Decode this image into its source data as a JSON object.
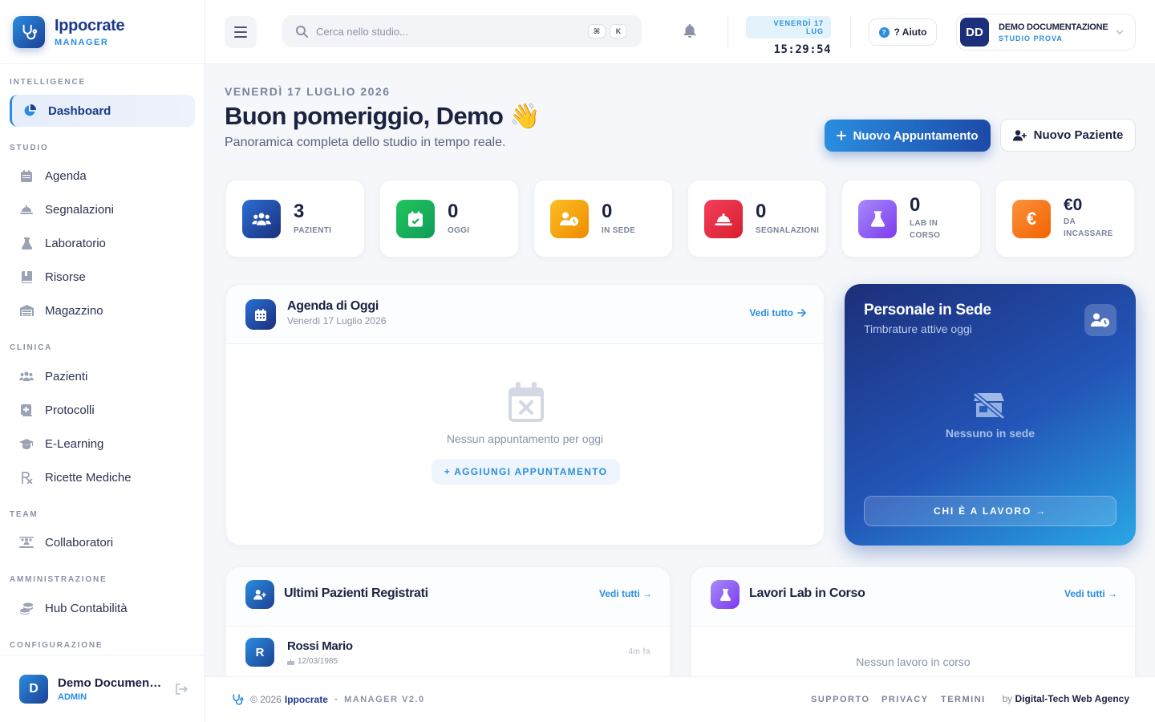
{
  "brand": {
    "name": "Ippocrate",
    "subtitle": "MANAGER"
  },
  "sidebar": {
    "sections": [
      {
        "label": "INTELLIGENCE"
      },
      {
        "label": "STUDIO"
      },
      {
        "label": "CLINICA"
      },
      {
        "label": "TEAM"
      },
      {
        "label": "AMMINISTRAZIONE"
      },
      {
        "label": "CONFIGURAZIONE"
      }
    ],
    "items": [
      {
        "label": "Dashboard",
        "icon": "chart-pie-icon",
        "active": true
      },
      {
        "label": "Agenda",
        "icon": "calendar-icon"
      },
      {
        "label": "Segnalazioni",
        "icon": "bell-concierge-icon"
      },
      {
        "label": "Laboratorio",
        "icon": "flask-icon"
      },
      {
        "label": "Risorse",
        "icon": "book-icon"
      },
      {
        "label": "Magazzino",
        "icon": "warehouse-icon"
      },
      {
        "label": "Pazienti",
        "icon": "users-icon"
      },
      {
        "label": "Protocolli",
        "icon": "notes-medical-icon"
      },
      {
        "label": "E-Learning",
        "icon": "graduation-cap-icon"
      },
      {
        "label": "Ricette Mediche",
        "icon": "prescription-icon"
      },
      {
        "label": "Collaboratori",
        "icon": "users-rectangle-icon"
      },
      {
        "label": "Hub Contabilità",
        "icon": "coins-icon"
      }
    ],
    "user": {
      "initial": "D",
      "name": "Demo Documentazione",
      "role": "ADMIN"
    }
  },
  "topbar": {
    "search_placeholder": "Cerca nello studio...",
    "shortcut": [
      "⌘",
      "K"
    ],
    "clock_date": "VENERDÌ 17 LUG",
    "clock_time": "15:29:54",
    "help_label": "? Aiuto",
    "profile": {
      "initials": "DD",
      "name": "DEMO DOCUMENTAZIONE",
      "studio": "STUDIO PROVA"
    }
  },
  "header": {
    "date": "VENERDÌ 17 LUGLIO 2026",
    "title": "Buon pomeriggio, Demo 👋",
    "subtitle": "Panoramica completa dello studio in tempo reale.",
    "primary_button": "Nuovo Appuntamento",
    "secondary_button": "Nuovo Paziente"
  },
  "stats": [
    {
      "value": "3",
      "label": "PAZIENTI",
      "color": "#1c4aa8",
      "icon": "users-icon"
    },
    {
      "value": "0",
      "label": "OGGI",
      "color": "#16a34a",
      "icon": "calendar-check-icon"
    },
    {
      "value": "0",
      "label": "IN SEDE",
      "color": "#f59e0b",
      "icon": "user-clock-icon"
    },
    {
      "value": "0",
      "label": "SEGNALAZIONI",
      "color": "#e11d48",
      "icon": "bell-concierge-icon"
    },
    {
      "value": "0",
      "label": "LAB IN CORSO",
      "color": "#8b5cf6",
      "icon": "flask-icon"
    },
    {
      "value": "€0",
      "label": "DA INCASSARE",
      "color": "#f97316",
      "icon": "euro-icon"
    }
  ],
  "agenda": {
    "title": "Agenda di Oggi",
    "subtitle": "Venerdì 17 Luglio 2026",
    "link": "Vedi tutto",
    "empty_text": "Nessun appuntamento per oggi",
    "add_label": "+ AGGIUNGI APPUNTAMENTO"
  },
  "staff": {
    "title": "Personale in Sede",
    "subtitle": "Timbrature attive oggi",
    "empty_text": "Nessuno in sede",
    "button": "CHI È A LAVORO →"
  },
  "patients": {
    "title": "Ultimi Pazienti Registrati",
    "link": "Vedi tutti →",
    "rows": [
      {
        "initial": "R",
        "name": "Rossi Mario",
        "birth": "12/03/1985",
        "ago": "4m fa"
      }
    ]
  },
  "lab": {
    "title": "Lavori Lab in Corso",
    "link": "Vedi tutti →",
    "empty_text": "Nessun lavoro in corso"
  },
  "footer": {
    "copyright": "© 2026",
    "brand": "Ippocrate",
    "version": "MANAGER V2.0",
    "links": [
      "SUPPORTO",
      "PRIVACY",
      "TERMINI"
    ],
    "by_prefix": "by",
    "agency": "Digital-Tech Web Agency"
  }
}
